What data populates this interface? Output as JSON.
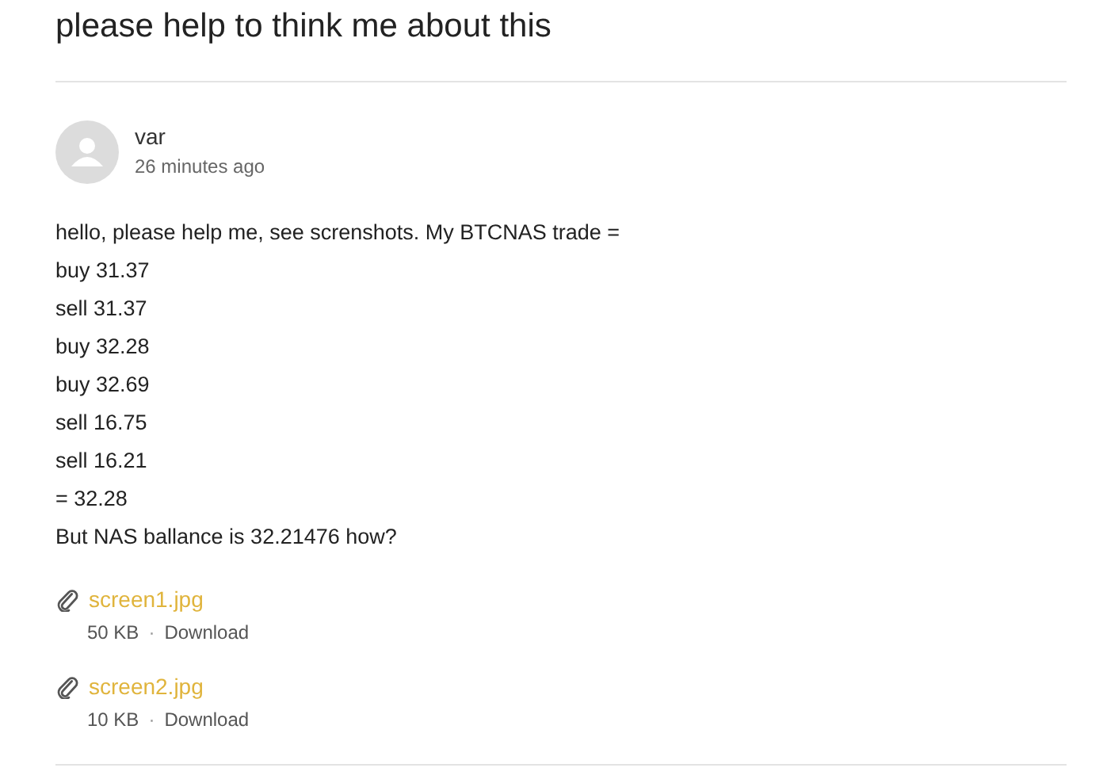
{
  "title": "please help to think me about this",
  "post": {
    "author": "var",
    "time": "26 minutes ago",
    "body": [
      "hello, please help me, see screnshots. My BTCNAS trade =",
      "buy 31.37",
      "sell 31.37",
      "buy 32.28",
      "buy 32.69",
      "sell 16.75",
      "sell 16.21",
      "= 32.28",
      "But NAS ballance is 32.21476 how?"
    ],
    "attachments": [
      {
        "name": "screen1.jpg",
        "size": "50 KB",
        "separator": "·",
        "action": "Download"
      },
      {
        "name": "screen2.jpg",
        "size": "10 KB",
        "separator": "·",
        "action": "Download"
      }
    ]
  }
}
